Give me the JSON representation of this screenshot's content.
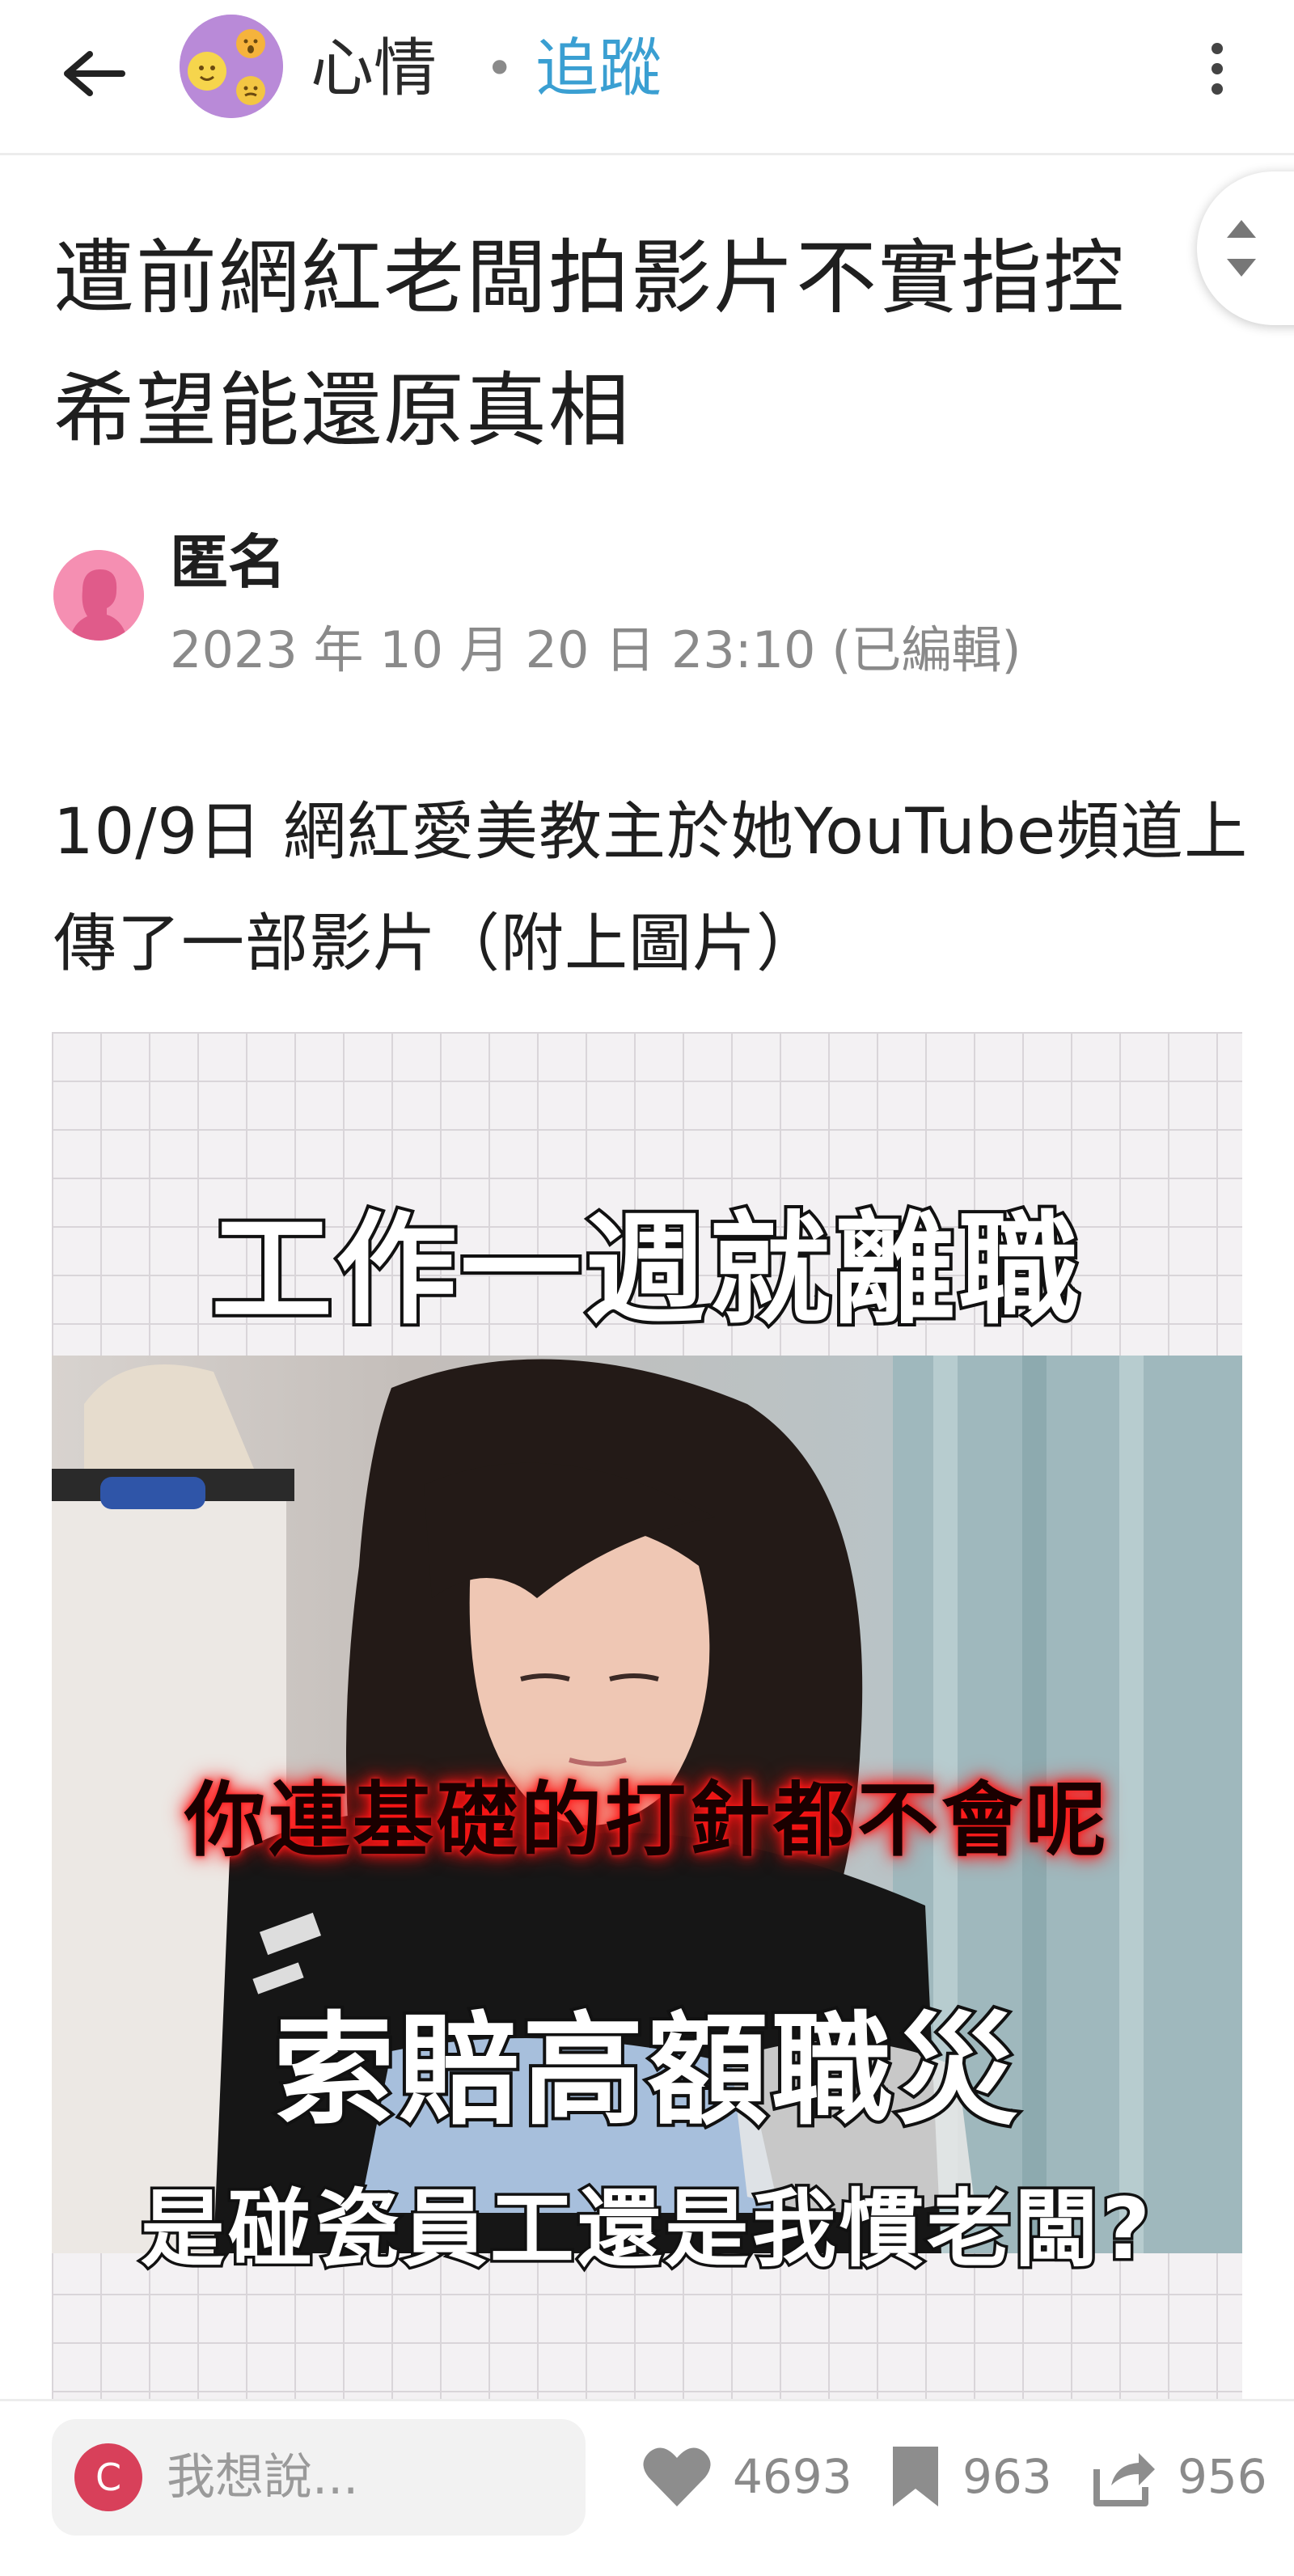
{
  "header": {
    "board_name": "心情",
    "separator": "•",
    "follow_label": "追蹤",
    "back_icon": "arrow-left-icon",
    "more_icon": "more-vertical-icon"
  },
  "scroll_helper": {
    "up_icon": "triangle-up-icon",
    "down_icon": "triangle-down-icon"
  },
  "post": {
    "title": "遭前網紅老闆拍影片不實指控 希望能還原真相",
    "author": "匿名",
    "time": "2023 年 10 月 20 日 23:10 (已編輯)",
    "body": "10/9日 網紅愛美教主於她YouTube頻道上傳了一部影片（附上圖片）",
    "image": {
      "caption_top": "工作一週就離職",
      "caption_mid": "你連基礎的打針都不會呢",
      "caption_bottom": "索賠高額職災",
      "caption_bottom2": "是碰瓷員工還是我慣老闆?"
    }
  },
  "actions": {
    "comment_avatar_letter": "C",
    "comment_placeholder": "我想說...",
    "likes": "4693",
    "saves": "963",
    "shares": "956"
  },
  "colors": {
    "accent": "#3a9fd2",
    "muted": "#8a8a8a",
    "avatar_pink": "#f58fb2",
    "comment_avatar": "#d8405a"
  }
}
